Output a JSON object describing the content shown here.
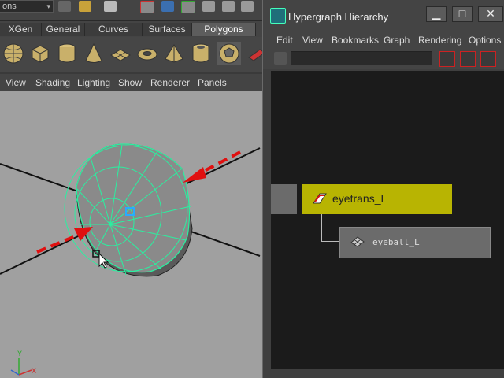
{
  "topbar": {
    "mode_value": "ons"
  },
  "shelf": {
    "tabs": [
      {
        "label": "XGen",
        "active": false
      },
      {
        "label": "General",
        "active": false
      },
      {
        "label": "Curves",
        "active": false
      },
      {
        "label": "Surfaces",
        "active": false
      },
      {
        "label": "Polygons",
        "active": true
      }
    ],
    "icons": [
      "sphere-icon",
      "cube-icon",
      "cylinder-icon",
      "cone-icon",
      "plane-icon",
      "torus-icon",
      "pyramid-icon",
      "pipe-icon",
      "soccer-ball-icon",
      "extra-icon"
    ]
  },
  "viewport": {
    "menu": [
      "View",
      "Shading",
      "Lighting",
      "Show",
      "Renderer",
      "Panels"
    ],
    "axis": {
      "y": "Y",
      "x": "X"
    }
  },
  "hypergraph": {
    "title": "Hypergraph Hierarchy",
    "menu": [
      "Edit",
      "View",
      "Bookmarks",
      "Graph",
      "Rendering",
      "Options"
    ],
    "nodes": {
      "parent": "eyetrans_L",
      "child": "eyeball_L"
    }
  },
  "colors": {
    "accent_node": "#b8b402",
    "wire": "#2af0a0",
    "arrow": "#e01010",
    "canvas": "#1b1b1b"
  }
}
